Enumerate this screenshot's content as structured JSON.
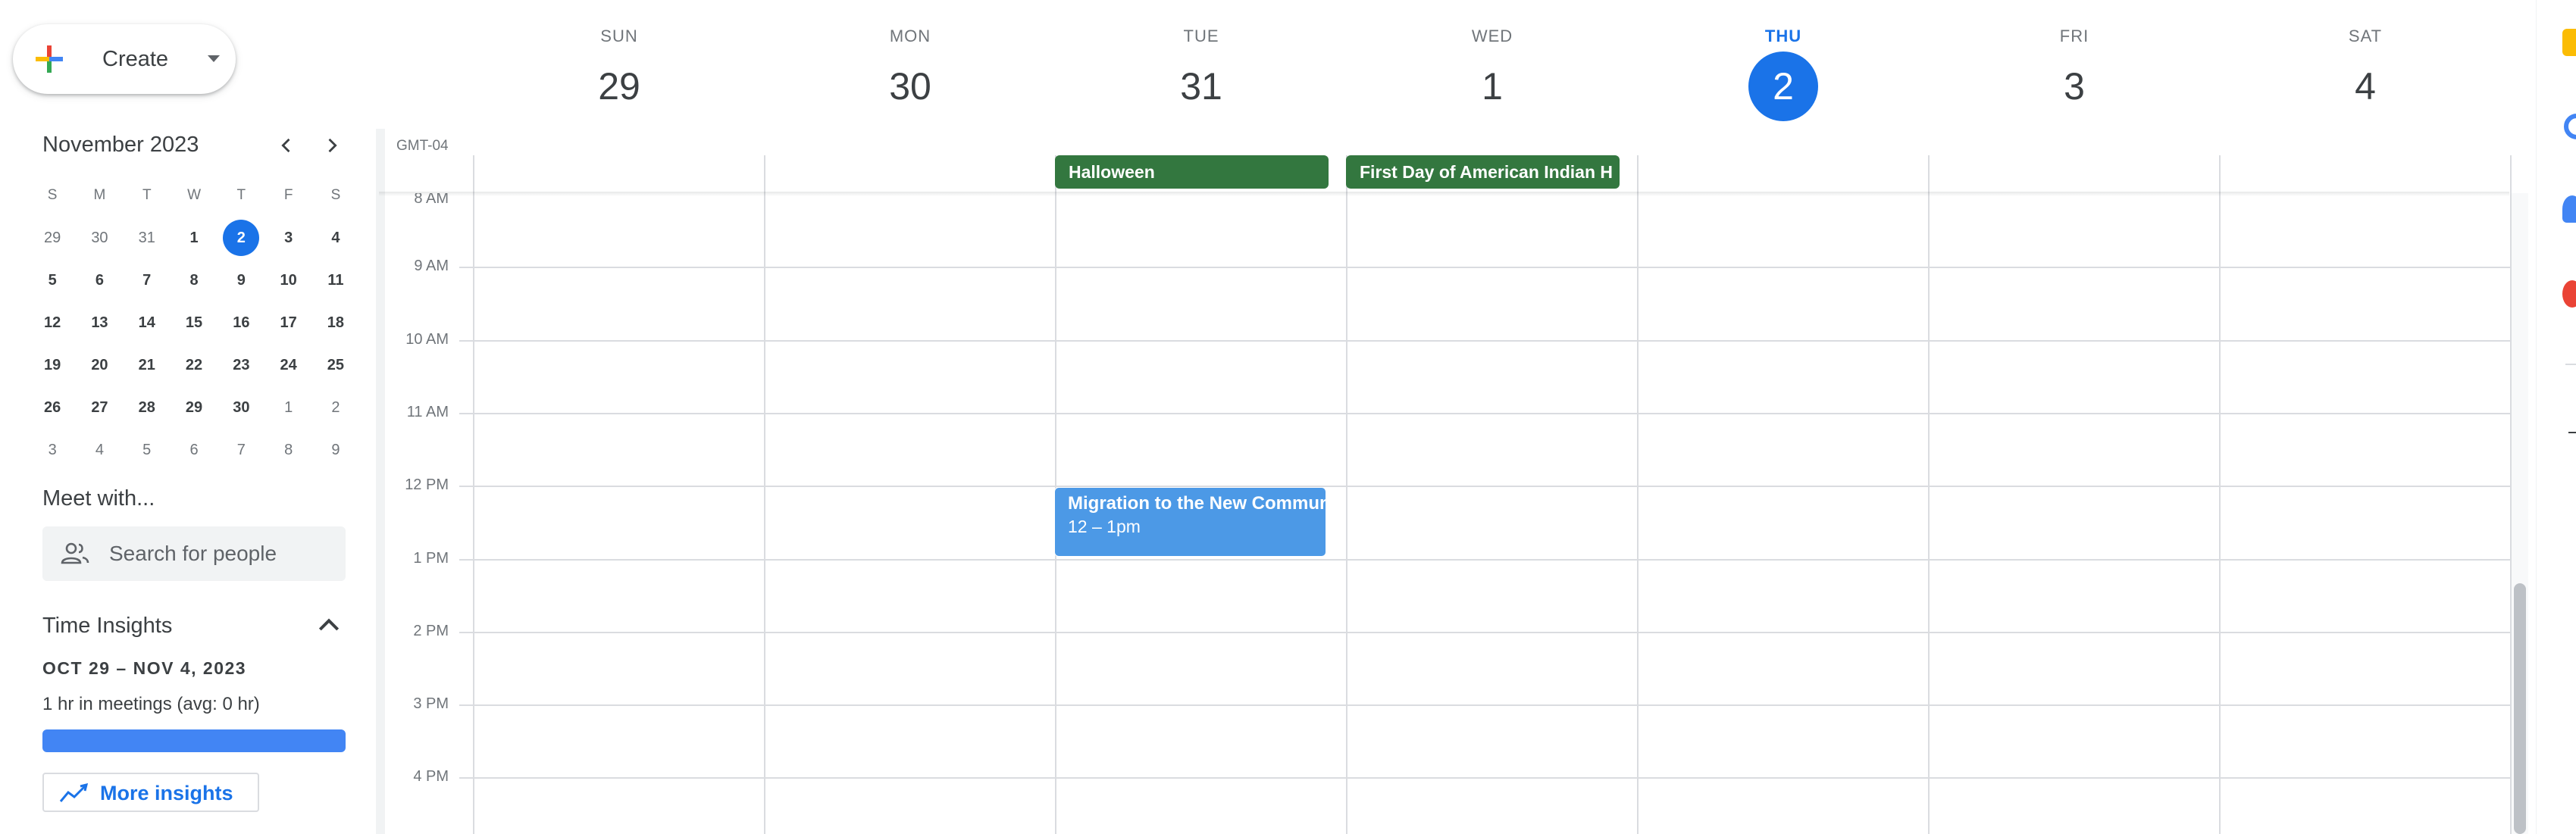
{
  "create": {
    "label": "Create"
  },
  "mini_calendar": {
    "title": "November 2023",
    "weekdays": [
      "S",
      "M",
      "T",
      "W",
      "T",
      "F",
      "S"
    ],
    "weeks": [
      [
        [
          "29",
          "other"
        ],
        [
          "30",
          "other"
        ],
        [
          "31",
          "other"
        ],
        [
          "1",
          ""
        ],
        [
          "2",
          "today"
        ],
        [
          "3",
          ""
        ],
        [
          "4",
          ""
        ]
      ],
      [
        [
          "5",
          ""
        ],
        [
          "6",
          ""
        ],
        [
          "7",
          ""
        ],
        [
          "8",
          ""
        ],
        [
          "9",
          ""
        ],
        [
          "10",
          ""
        ],
        [
          "11",
          ""
        ]
      ],
      [
        [
          "12",
          ""
        ],
        [
          "13",
          ""
        ],
        [
          "14",
          ""
        ],
        [
          "15",
          ""
        ],
        [
          "16",
          ""
        ],
        [
          "17",
          ""
        ],
        [
          "18",
          ""
        ]
      ],
      [
        [
          "19",
          ""
        ],
        [
          "20",
          ""
        ],
        [
          "21",
          ""
        ],
        [
          "22",
          ""
        ],
        [
          "23",
          ""
        ],
        [
          "24",
          ""
        ],
        [
          "25",
          ""
        ]
      ],
      [
        [
          "26",
          ""
        ],
        [
          "27",
          ""
        ],
        [
          "28",
          ""
        ],
        [
          "29",
          ""
        ],
        [
          "30",
          ""
        ],
        [
          "1",
          "other"
        ],
        [
          "2",
          "other"
        ]
      ],
      [
        [
          "3",
          "other"
        ],
        [
          "4",
          "other"
        ],
        [
          "5",
          "other"
        ],
        [
          "6",
          "other"
        ],
        [
          "7",
          "other"
        ],
        [
          "8",
          "other"
        ],
        [
          "9",
          "other"
        ]
      ]
    ]
  },
  "meet": {
    "title": "Meet with...",
    "search_placeholder": "Search for people"
  },
  "time_insights": {
    "title": "Time Insights",
    "range": "OCT 29 – NOV 4, 2023",
    "meetings": "1 hr in meetings (avg: 0 hr)",
    "meeting_fraction": 1.0,
    "more_label": "More insights"
  },
  "week": {
    "days": [
      {
        "name": "SUN",
        "num": "29",
        "today": false
      },
      {
        "name": "MON",
        "num": "30",
        "today": false
      },
      {
        "name": "TUE",
        "num": "31",
        "today": false
      },
      {
        "name": "WED",
        "num": "1",
        "today": false
      },
      {
        "name": "THU",
        "num": "2",
        "today": true
      },
      {
        "name": "FRI",
        "num": "3",
        "today": false
      },
      {
        "name": "SAT",
        "num": "4",
        "today": false
      }
    ],
    "timezone": "GMT-04",
    "hours": [
      "8 AM",
      "9 AM",
      "10 AM",
      "11 AM",
      "12 PM",
      "1 PM",
      "2 PM",
      "3 PM",
      "4 PM"
    ]
  },
  "all_day_events": [
    {
      "title": "Halloween",
      "day_index": 2,
      "color": "#33773f"
    },
    {
      "title": "First Day of American Indian H",
      "day_index": 3,
      "color": "#33773f"
    }
  ],
  "timed_events": [
    {
      "title": "Migration to the New Communi",
      "time": "12 – 1pm",
      "day_index": 2,
      "color": "#4c99e6"
    }
  ],
  "colors": {
    "accent": "#1a73e8",
    "holiday": "#33773f",
    "event": "#4c99e6"
  }
}
